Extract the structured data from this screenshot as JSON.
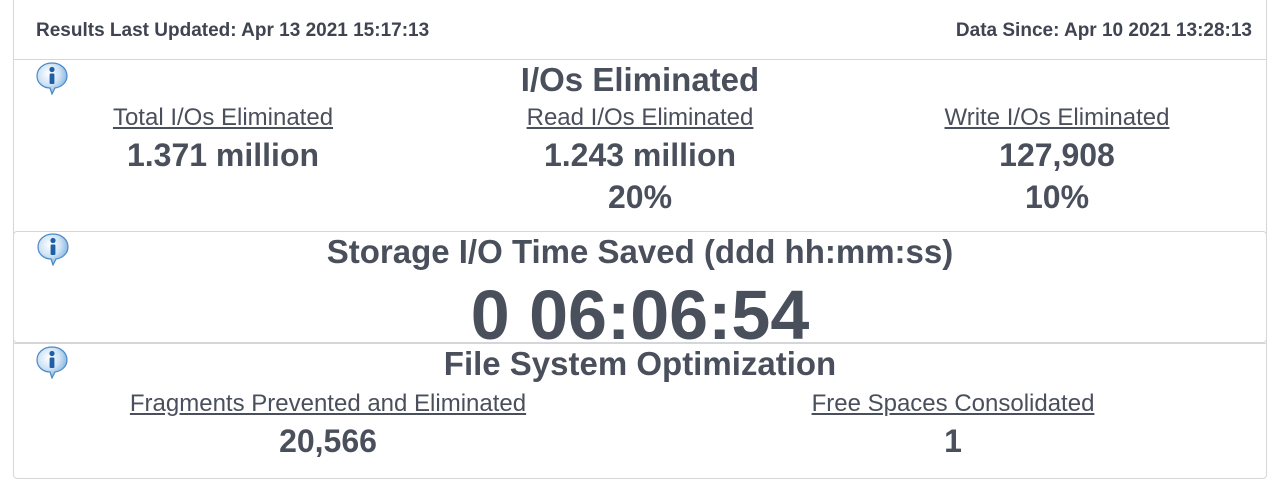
{
  "header": {
    "last_updated": "Results Last Updated: Apr 13 2021 15:17:13",
    "data_since": "Data Since: Apr 10 2021 13:28:13"
  },
  "ios_panel": {
    "title": "I/Os Eliminated",
    "total": {
      "label": "Total I/Os Eliminated",
      "value": "1.371 million"
    },
    "read": {
      "label": "Read I/Os Eliminated",
      "value": "1.243 million",
      "percent": "20%"
    },
    "write": {
      "label": "Write I/Os Eliminated",
      "value": "127,908",
      "percent": "10%"
    }
  },
  "time_panel": {
    "title": "Storage I/O Time Saved (ddd hh:mm:ss)",
    "value": "0 06:06:54"
  },
  "fs_panel": {
    "title": "File System Optimization",
    "fragments": {
      "label": "Fragments Prevented and Eliminated",
      "value": "20,566"
    },
    "free_spaces": {
      "label": "Free Spaces Consolidated",
      "value": "1"
    }
  },
  "icons": {
    "info": "info-icon"
  },
  "colors": {
    "text": "#4a4f5c",
    "border": "#d4d6da",
    "info_blue": "#3d8fd6"
  }
}
